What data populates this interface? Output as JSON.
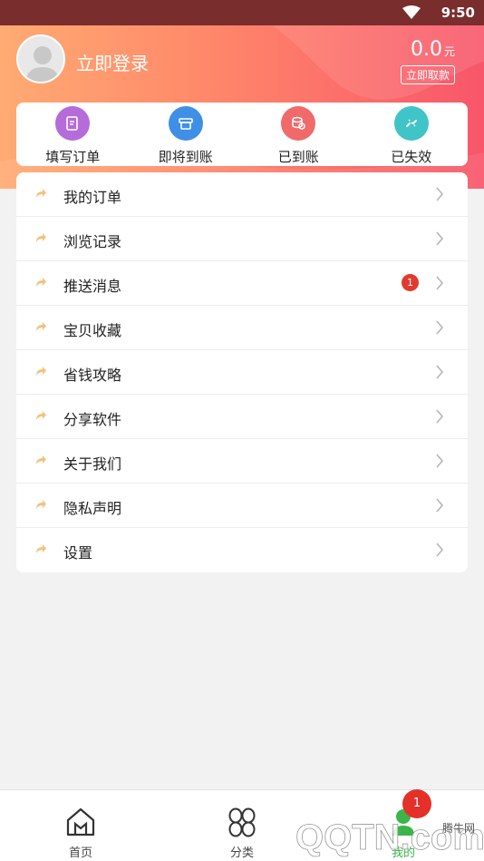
{
  "status_bar": {
    "time": "9:50"
  },
  "header": {
    "login_text": "立即登录",
    "balance": "0.0",
    "balance_unit": "元",
    "withdraw_label": "立即取款"
  },
  "orders": [
    {
      "label": "填写订单",
      "icon": "edit-order-icon",
      "color": "#b063d6"
    },
    {
      "label": "即将到账",
      "icon": "pending-icon",
      "color": "#3f8fe6"
    },
    {
      "label": "已到账",
      "icon": "coins-icon",
      "color": "#f06a6a"
    },
    {
      "label": "已失效",
      "icon": "broken-link-icon",
      "color": "#3fc4c8"
    }
  ],
  "menu": [
    {
      "label": "我的订单"
    },
    {
      "label": "浏览记录"
    },
    {
      "label": "推送消息",
      "badge": "1"
    },
    {
      "label": "宝贝收藏"
    },
    {
      "label": "省钱攻略"
    },
    {
      "label": "分享软件"
    },
    {
      "label": "关于我们"
    },
    {
      "label": "隐私声明"
    },
    {
      "label": "设置"
    }
  ],
  "tabs": [
    {
      "label": "首页",
      "icon": "home-icon"
    },
    {
      "label": "分类",
      "icon": "category-icon"
    },
    {
      "label": "我的",
      "icon": "profile-icon"
    }
  ],
  "tab_badge": "1",
  "watermark": {
    "text": "腾牛网"
  },
  "colors": {
    "accent": "#f8566a",
    "arrow": "#f3c27a",
    "active_tab": "#3bb54a"
  }
}
